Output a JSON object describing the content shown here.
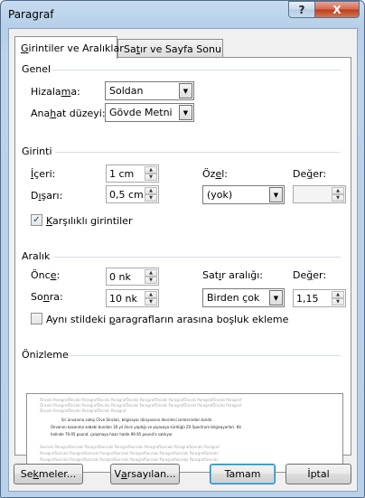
{
  "window": {
    "title": "Paragraf",
    "help_label": "?",
    "close_label": "X"
  },
  "tabs": [
    {
      "label_u": "G",
      "label_rest": "irintiler ve Aralıklar"
    },
    {
      "label_pre": "Sa",
      "label_u": "t",
      "label_rest": "ır ve Sayfa Sonu"
    }
  ],
  "general": {
    "heading": "Genel",
    "alignment_label_pre": "Hizala",
    "alignment_label_u": "m",
    "alignment_label_post": "a:",
    "alignment_value": "Soldan",
    "outline_label_pre": "Ana",
    "outline_label_u": "h",
    "outline_label_post": "at düzeyi:",
    "outline_value": "Gövde Metni"
  },
  "indent": {
    "heading": "Girinti",
    "inner_label_u": "İ",
    "inner_label_rest": "çeri:",
    "inner_value": "1 cm",
    "outer_label_pre": "D",
    "outer_label_u": "ı",
    "outer_label_post": "şarı:",
    "outer_value": "0,5 cm",
    "special_label_pre": "Öz",
    "special_label_u": "e",
    "special_label_post": "l:",
    "special_value": "(yok)",
    "value_label_pre": "De",
    "value_label_u": "ğ",
    "value_label_post": "er:",
    "value_value": "",
    "mirror_label_u": "K",
    "mirror_label_rest": "arşılıklı girintiler",
    "mirror_checked": "✓"
  },
  "spacing": {
    "heading": "Aralık",
    "before_label_pre": "Önc",
    "before_label_u": "e",
    "before_label_post": ":",
    "before_value": "0 nk",
    "after_label_pre": "So",
    "after_label_u": "n",
    "after_label_post": "ra:",
    "after_value": "10 nk",
    "line_label_pre": "Sat",
    "line_label_u": "ı",
    "line_label_post": "r aralığı:",
    "line_value": "Birden çok",
    "value_label_pre": "De",
    "value_label_u": "ğ",
    "value_label_post": "er:",
    "value_value": "1,15",
    "nospace_label_pre": "Aynı stildeki ",
    "nospace_label_u": "p",
    "nospace_label_post": "aragrafların arasına boşluk ekleme"
  },
  "preview": {
    "heading": "Önizleme",
    "prev_lines": [
      "Önceki ParagrafÖnceki ParagrafÖnceki ParagrafÖnceki ParagrafÖnceki ParagrafÖnceki ParagrafÖnceki Paragraf",
      "Önceki ParagrafÖnceki ParagrafÖnceki ParagrafÖnceki ParagrafÖnceki ParagrafÖnceki ParagrafÖnceki Paragraf",
      "Önceki ParagrafÖnceki ParagrafÖnceki Paragraf"
    ],
    "main_lines": [
      "Sir ünvanına sahip Clive Sinclair, bilgisayar dünyasının devrimci isimlerinden biridir.",
      "Ünvanını kazanma sebebi bundan 30 yıl önce yaptığı ve piyasaya sürdüğü ZX Spectrum bilgisayarları. Kit",
      "halinde 79.95 pound, çalışmaya hazır halde 99.95 pound'a satılıyor."
    ],
    "next_lines": [
      "Sonraki ParagrafSonraki ParagrafSonraki ParagrafSonraki ParagrafSonraki ParagrafSonraki Paragraf",
      "ParagrafSonraki ParagrafSonraki ParagrafSonraki ParagrafSonraki ParagrafSonraki ParagrafSonraki",
      "ParagrafSonraki ParagrafSonraki ParagrafSonraki ParagrafSonraki ParagrafSonraki ParagrafSonraki"
    ]
  },
  "buttons": {
    "tabs_pre": "Se",
    "tabs_u": "k",
    "tabs_post": "meler...",
    "default_pre": "V",
    "default_u": "a",
    "default_post": "rsayılan...",
    "ok": "Tamam",
    "cancel": "İptal"
  }
}
